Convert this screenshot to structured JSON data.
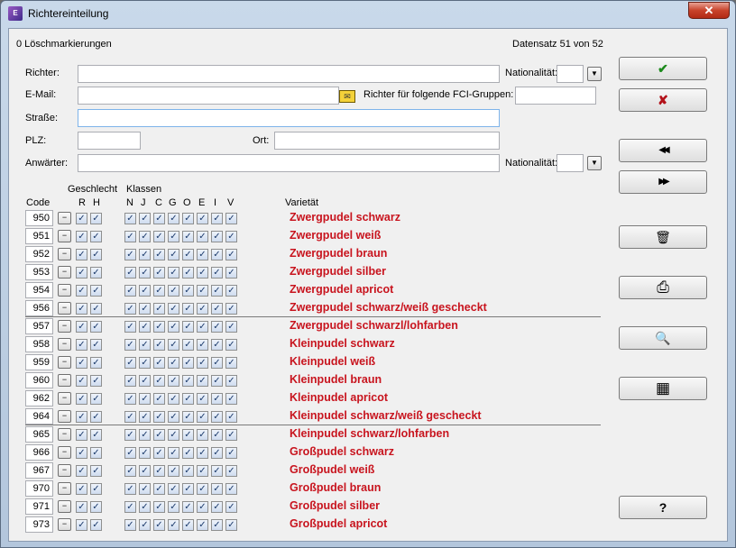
{
  "window": {
    "title": "Richtereinteilung",
    "close": "✕"
  },
  "status": {
    "delete_marks": "0 Löschmarkierungen",
    "record": "Datensatz 51 von 52"
  },
  "form": {
    "richter_label": "Richter:",
    "email_label": "E-Mail:",
    "strasse_label": "Straße:",
    "plz_label": "PLZ:",
    "ort_label": "Ort:",
    "anwaerter_label": "Anwärter:",
    "nationalitaet_label": "Nationalität:",
    "fci_label": "Richter für folgende FCI-Gruppen:",
    "richter_value": "",
    "email_value": "",
    "strasse_value": "",
    "plz_value": "",
    "ort_value": "",
    "anwaerter_value": "",
    "nat1_value": "",
    "nat2_value": "",
    "fci_value": ""
  },
  "table": {
    "code_header": "Code",
    "geschlecht_header": "Geschlecht",
    "klassen_header": "Klassen",
    "varietaet_header": "Varietät",
    "sex_cols": [
      "R",
      "H"
    ],
    "class_cols": [
      "N",
      "J",
      "C",
      "G",
      "O",
      "E",
      "I",
      "V"
    ],
    "rows": [
      {
        "code": "950",
        "variety": "Zwergpudel schwarz"
      },
      {
        "code": "951",
        "variety": "Zwergpudel weiß"
      },
      {
        "code": "952",
        "variety": "Zwergpudel braun"
      },
      {
        "code": "953",
        "variety": "Zwergpudel silber"
      },
      {
        "code": "954",
        "variety": "Zwergpudel apricot"
      },
      {
        "code": "956",
        "variety": "Zwergpudel schwarz/weiß gescheckt"
      },
      {
        "code": "957",
        "variety": "Zwergpudel schwarzl/lohfarben"
      },
      {
        "code": "958",
        "variety": "Kleinpudel schwarz"
      },
      {
        "code": "959",
        "variety": "Kleinpudel weiß"
      },
      {
        "code": "960",
        "variety": "Kleinpudel braun"
      },
      {
        "code": "962",
        "variety": "Kleinpudel apricot"
      },
      {
        "code": "964",
        "variety": "Kleinpudel schwarz/weiß gescheckt"
      },
      {
        "code": "965",
        "variety": "Kleinpudel schwarz/lohfarben"
      },
      {
        "code": "966",
        "variety": "Großpudel schwarz"
      },
      {
        "code": "967",
        "variety": "Großpudel weiß"
      },
      {
        "code": "970",
        "variety": "Großpudel braun"
      },
      {
        "code": "971",
        "variety": "Großpudel silber"
      },
      {
        "code": "973",
        "variety": "Großpudel apricot"
      }
    ],
    "separators_after_rows": [
      5,
      11
    ],
    "checkbox_checked": true,
    "minus_label": "−",
    "check_mark": "✓"
  },
  "sidebar": {
    "ok_icon": "✔",
    "cancel_icon": "✘",
    "first_icon": "◀◀",
    "last_icon": "▶▶",
    "delete_icon": "🗑",
    "print_icon": "⎙",
    "search_icon": "🔍",
    "table_icon": "▦",
    "help_icon": "?"
  },
  "colors": {
    "variety_text": "#c8141e",
    "ok_green": "#1c8a1c",
    "cancel_red": "#b3121a"
  }
}
